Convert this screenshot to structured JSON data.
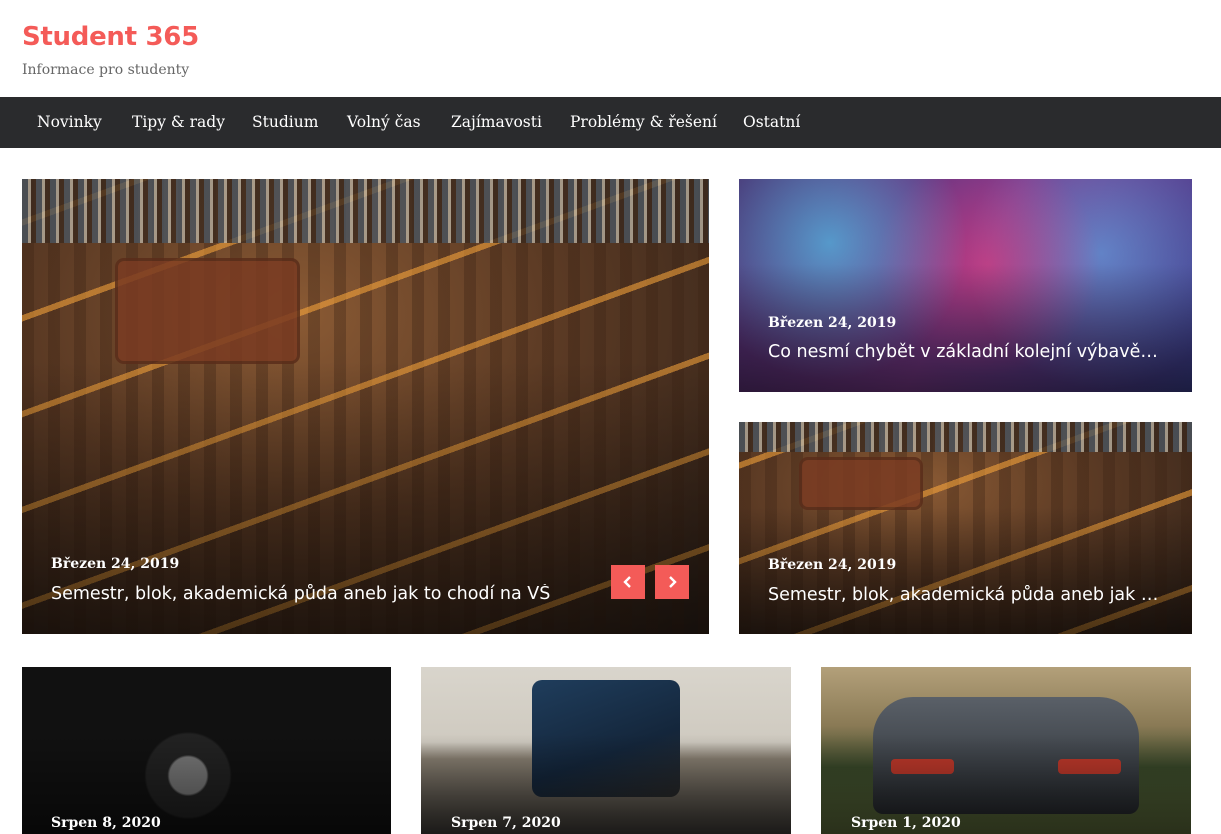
{
  "site": {
    "title": "Student 365",
    "description": "Informace pro studenty",
    "accent_color": "#f45b58"
  },
  "nav": {
    "items": [
      {
        "label": "Novinky"
      },
      {
        "label": "Tipy & rady"
      },
      {
        "label": "Studium"
      },
      {
        "label": "Volný čas"
      },
      {
        "label": "Zajímavosti"
      },
      {
        "label": "Problémy & řešení"
      },
      {
        "label": "Ostatní"
      }
    ]
  },
  "slider": {
    "date": "Březen 24, 2019",
    "title": "Semestr, blok, akademická půda aneb jak to chodí na VŠ",
    "prev_icon": "chevron-left-icon",
    "next_icon": "chevron-right-icon"
  },
  "side_posts": [
    {
      "date": "Březen 24, 2019",
      "title": "Co nesmí chybět v základní kolejní výbavě…"
    },
    {
      "date": "Březen 24, 2019",
      "title": "Semestr, blok, akademická půda aneb jak …"
    }
  ],
  "grid_posts": [
    {
      "date": "Srpen 8, 2020"
    },
    {
      "date": "Srpen 7, 2020"
    },
    {
      "date": "Srpen 1, 2020"
    }
  ]
}
